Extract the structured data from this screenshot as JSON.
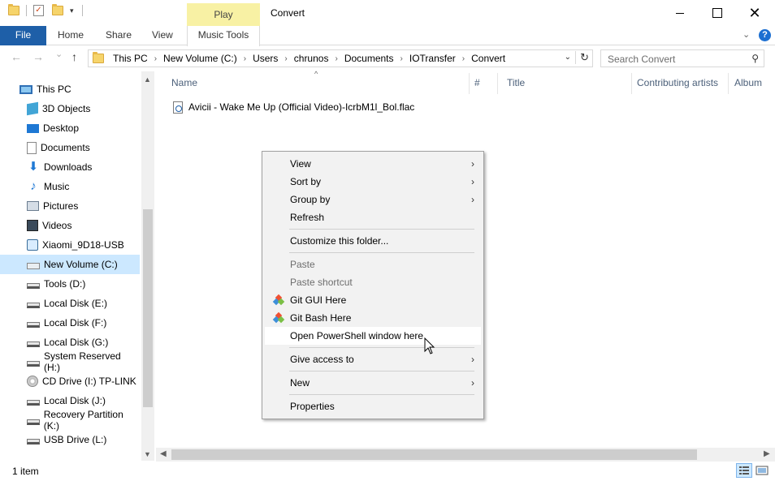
{
  "window": {
    "title": "Convert",
    "contextual_tab": "Play",
    "controls": {
      "minimize": "minimize",
      "maximize": "maximize",
      "close": "✕"
    }
  },
  "ribbon": {
    "tabs": [
      "File",
      "Home",
      "Share",
      "View",
      "Music Tools"
    ],
    "help": "?"
  },
  "navigation": {
    "back": "←",
    "forward": "→",
    "recent": "⌄",
    "up": "↑"
  },
  "address": {
    "crumbs": [
      "This PC",
      "New Volume (C:)",
      "Users",
      "chrunos",
      "Documents",
      "IOTransfer",
      "Convert"
    ],
    "separator": "›",
    "dropdown": "⌄",
    "refresh": "↻"
  },
  "search": {
    "placeholder": "Search Convert",
    "icon": "⚲"
  },
  "sidebar": {
    "items": [
      {
        "label": "This PC",
        "icon": "computer-icon"
      },
      {
        "label": "3D Objects",
        "icon": "3d-objects-icon"
      },
      {
        "label": "Desktop",
        "icon": "desktop-icon"
      },
      {
        "label": "Documents",
        "icon": "documents-icon"
      },
      {
        "label": "Downloads",
        "icon": "downloads-icon"
      },
      {
        "label": "Music",
        "icon": "music-icon"
      },
      {
        "label": "Pictures",
        "icon": "pictures-icon"
      },
      {
        "label": "Videos",
        "icon": "videos-icon"
      },
      {
        "label": "Xiaomi_9D18-USB",
        "icon": "phone-icon"
      },
      {
        "label": "New Volume (C:)",
        "icon": "windows-drive-icon",
        "selected": true
      },
      {
        "label": "Tools (D:)",
        "icon": "drive-icon"
      },
      {
        "label": "Local Disk (E:)",
        "icon": "drive-icon"
      },
      {
        "label": "Local Disk (F:)",
        "icon": "drive-icon"
      },
      {
        "label": "Local Disk (G:)",
        "icon": "drive-icon"
      },
      {
        "label": "System Reserved (H:)",
        "icon": "drive-icon"
      },
      {
        "label": "CD Drive (I:) TP-LINK",
        "icon": "cd-drive-icon"
      },
      {
        "label": "Local Disk (J:)",
        "icon": "drive-icon"
      },
      {
        "label": "Recovery Partition (K:)",
        "icon": "drive-icon"
      },
      {
        "label": "USB Drive (L:)",
        "icon": "drive-icon"
      }
    ],
    "scroll_up": "▲",
    "scroll_down": "▼"
  },
  "columns": [
    "Name",
    "#",
    "Title",
    "Contributing artists",
    "Album"
  ],
  "sort_indicator": "^",
  "files": [
    {
      "name": "Avicii - Wake Me Up (Official Video)-IcrbM1l_Bol.flac",
      "icon": "flac-file-icon"
    }
  ],
  "context_menu": {
    "items": [
      {
        "label": "View",
        "submenu": true
      },
      {
        "label": "Sort by",
        "submenu": true
      },
      {
        "label": "Group by",
        "submenu": true
      },
      {
        "label": "Refresh"
      },
      {
        "label": "Customize this folder..."
      },
      {
        "label": "Paste",
        "disabled": true
      },
      {
        "label": "Paste shortcut",
        "disabled": true
      },
      {
        "label": "Git GUI Here",
        "icon": "git-icon"
      },
      {
        "label": "Git Bash Here",
        "icon": "git-icon"
      },
      {
        "label": "Open PowerShell window here",
        "hover": true
      },
      {
        "label": "Give access to",
        "submenu": true
      },
      {
        "label": "New",
        "submenu": true
      },
      {
        "label": "Properties"
      }
    ],
    "submenu_arrow": "›"
  },
  "hscroll": {
    "left": "◀",
    "right": "▶"
  },
  "status": {
    "text": "1 item"
  },
  "colors": {
    "file_tab": "#1e5fa8",
    "play_tab": "#f8f1a4",
    "selection": "#cce8ff",
    "header_text": "#4c607a"
  }
}
